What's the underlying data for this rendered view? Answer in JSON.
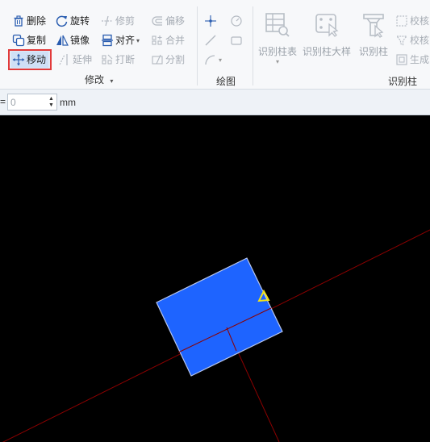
{
  "modify_group": {
    "label": "修改",
    "delete_label": "删除",
    "rotate_label": "旋转",
    "trim_label": "修剪",
    "offset_label": "偏移",
    "copy_label": "复制",
    "mirror_label": "镜像",
    "align_label": "对齐",
    "merge_label": "合并",
    "move_label": "移动",
    "extend_label": "延伸",
    "break_label": "打断",
    "split_label": "分割"
  },
  "draw_group": {
    "label": "绘图"
  },
  "recognize_group": {
    "label": "识别柱",
    "column_table_label": "识别柱表",
    "column_detail_label": "识别柱大样",
    "column_label": "识别柱",
    "check1_label": "校核",
    "check2_label": "校核",
    "generate_label": "生成"
  },
  "options_bar": {
    "prefix": "=",
    "value": "0",
    "unit": "mm"
  },
  "colors": {
    "column_fill": "#1e64ff",
    "axis_line": "#8b0000",
    "highlight_border": "#e23a3a",
    "marker": "#f2e21a"
  }
}
